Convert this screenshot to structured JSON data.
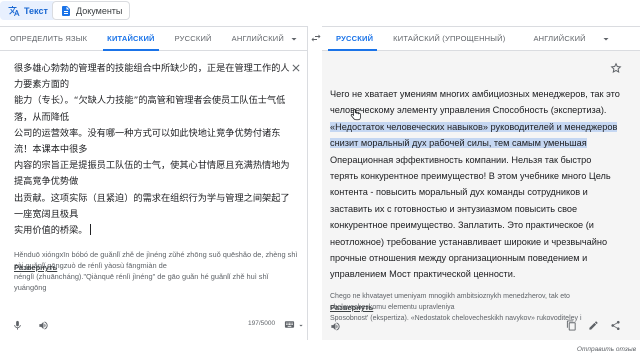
{
  "modes": {
    "text_label": "Текст",
    "docs_label": "Документы"
  },
  "source": {
    "tabs": [
      "ОПРЕДЕЛИТЬ ЯЗЫК",
      "КИТАЙСКИЙ",
      "РУССКИЙ",
      "АНГЛИЙСКИЙ"
    ],
    "active_tab": 1,
    "text": "很多雄心勃勃的管理者的技能组合中所缺少的，正是在管理工作的人力要素方面的\n能力（专长）。“欠缺人力技能”的高管和管理者会使员工队伍士气低落，从而降低\n公司的运营效率。没有哪一种方式可以如此快地让竞争优势付诸东流！本课本中很多\n内容的宗旨正是提振员工队伍的士气，使其心甘情愿且充满热情地为提高竞争优势做\n出贡献。这项实际（且紧迫）的需求在组织行为学与管理之间架起了一座宽阔且极具\n实用价值的桥梁。",
    "transliteration": "Hěnduō xióngxīn bóbó de guǎnlǐ zhě de jìnéng zǔhé zhōng suǒ quēshǎo de, zhèng shì zài guǎnlǐ gōngzuò de rénlì yàosù fāngmiàn de\nnénglì (zhuāncháng).\"Qiànquē rénlì jìnéng\" de gāo guǎn hé guǎnlǐ zhě huì shǐ yuángōng",
    "expand_label": "Развернуть",
    "counter": "197/5000"
  },
  "target": {
    "tabs": [
      "РУССКИЙ",
      "КИТАЙСКИЙ (УПРОЩЕННЫЙ)",
      "АНГЛИЙСКИЙ"
    ],
    "active_tab": 0,
    "text_before": "Чего не хватает умениям многих амбициозных менеджеров, так это человеческому элементу управления Способность (экспертиза). ",
    "text_highlight": "«Недостаток человеческих навыков» руководителей и менеджеров снизит моральный дух рабочей силы, тем самым уменьшая",
    "text_after": " Операционная эффективность компании. Нельзя так быстро терять конкурентное преимущество! В этом учебнике много Цель контента - повысить моральный дух команды сотрудников и заставить их с готовностью и энтузиазмом повысить свое конкурентное преимущество. Заплатить. Это практическое (и неотложное) требование устанавливает широкие и чрезвычайно прочные отношения между организационным поведением и управлением Мост практической ценности.",
    "transliteration": "Chego ne khvatayet umeniyam mnogikh ambitsioznykh menedzherov, tak eto chelovecheskomu elementu upravleniya\nSposobnost' (ekspertiza). «Nedostatok chelovecheskikh navykov» rukovoditeley i",
    "expand_label": "Развернуть"
  },
  "feedback_label": "Отправить отзыв",
  "colors": {
    "accent": "#1a73e8",
    "highlight": "#c5d7f2",
    "target_bg": "#f5f5f5"
  }
}
